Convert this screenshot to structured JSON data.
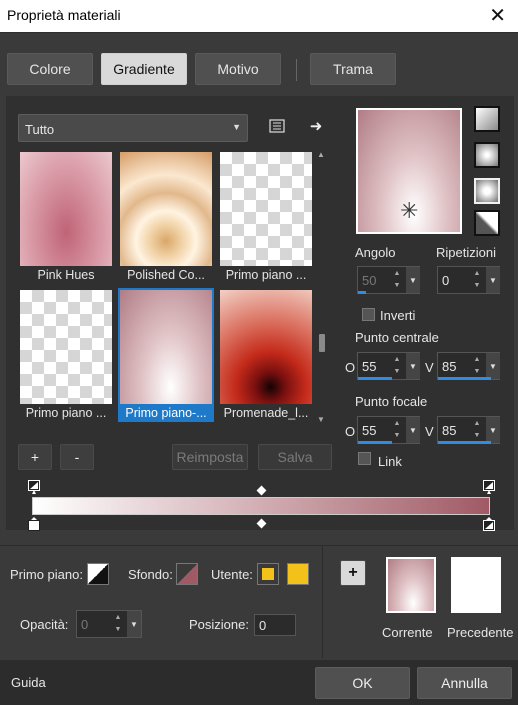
{
  "window": {
    "title": "Proprietà materiali",
    "close_glyph": "✕"
  },
  "tabs": [
    {
      "label": "Colore",
      "active": false
    },
    {
      "label": "Gradiente",
      "active": true
    },
    {
      "label": "Motivo",
      "active": false
    },
    {
      "label": "Trama",
      "active": false
    }
  ],
  "gallery": {
    "category": "Tutto",
    "items": [
      {
        "label": "Pink Hues",
        "selected": false
      },
      {
        "label": "Polished Co...",
        "selected": false
      },
      {
        "label": "Primo piano ...",
        "selected": false
      },
      {
        "label": "Primo piano ...",
        "selected": false
      },
      {
        "label": "Primo piano-...",
        "selected": true
      },
      {
        "label": "Promenade_l...",
        "selected": false
      }
    ],
    "add_label": "+",
    "remove_label": "-",
    "reset_label": "Reimposta",
    "save_label": "Salva"
  },
  "settings": {
    "angle_label": "Angolo",
    "angle_value": "50",
    "repeats_label": "Ripetizioni",
    "repeats_value": "0",
    "invert_label": "Inverti",
    "center_label": "Punto centrale",
    "center_h_label": "O",
    "center_h_value": "55",
    "center_v_label": "V",
    "center_v_value": "85",
    "focal_label": "Punto focale",
    "focal_h_label": "O",
    "focal_h_value": "55",
    "focal_v_label": "V",
    "focal_v_value": "85",
    "link_label": "Link"
  },
  "gradient_colors": {
    "start": "#ffffff",
    "mid": "#d6b6bb",
    "end": "#a05a65"
  },
  "stops": {
    "foreground_label": "Primo piano:",
    "background_label": "Sfondo:",
    "user_label": "Utente:",
    "user_color": "#f2c21a",
    "opacity_label": "Opacità:",
    "opacity_value": "0",
    "position_label": "Posizione:",
    "position_value": "0",
    "current_label": "Corrente",
    "previous_label": "Precedente",
    "add_glyph": "+"
  },
  "footer": {
    "help_label": "Guida",
    "ok_label": "OK",
    "cancel_label": "Annulla"
  }
}
